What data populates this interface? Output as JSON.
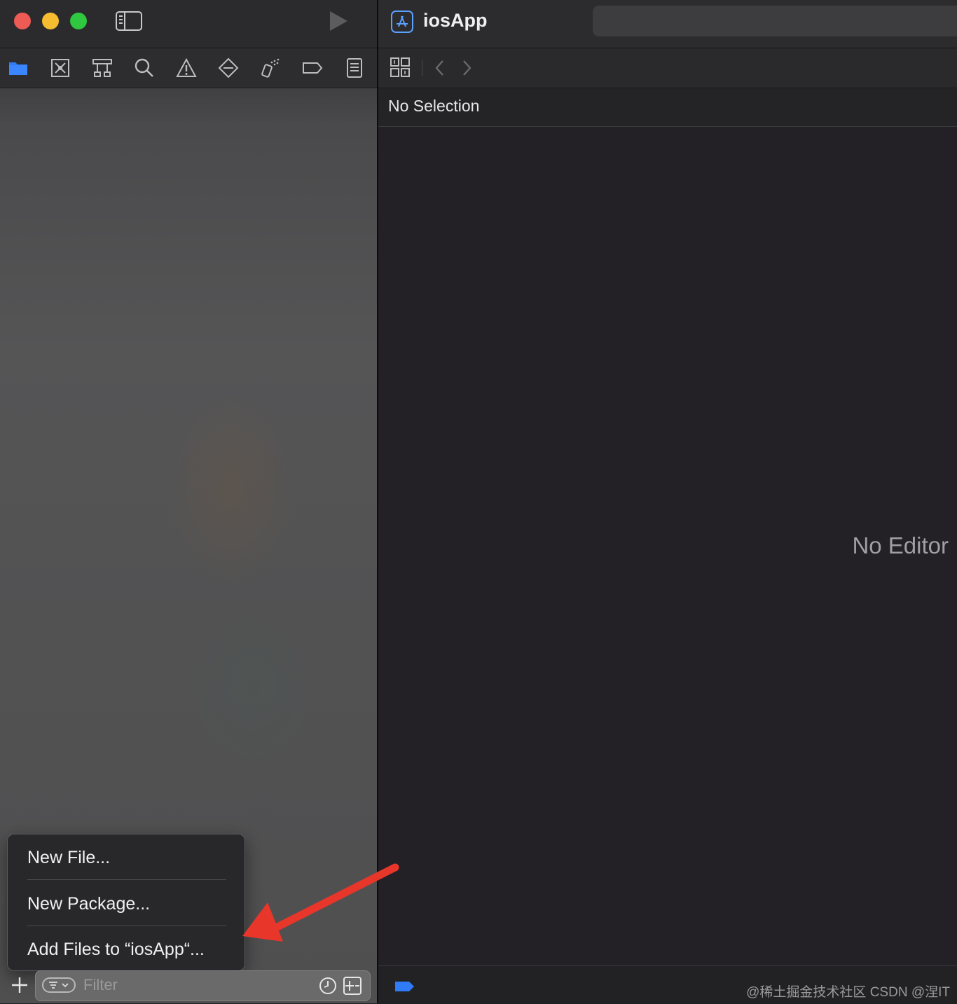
{
  "navigator": {
    "filter_placeholder": "Filter"
  },
  "menu": {
    "items": [
      {
        "label": "New File..."
      },
      {
        "label": "New Package..."
      },
      {
        "label": "Add Files to “iosApp“..."
      }
    ]
  },
  "editor": {
    "project_title": "iosApp",
    "jump_bar_text": "No Selection",
    "empty_message": "No Editor"
  },
  "watermark": "@稀土掘金技术社区 CSDN @涅IT",
  "colors": {
    "accent": "#2f7cf6",
    "close": "#ee5b55",
    "minimize": "#f5bd2f",
    "maximize": "#2fc840",
    "annotation_arrow": "#e8362b"
  },
  "icons": {
    "toolbar": [
      "folder-icon",
      "source-control-icon",
      "symbol-icon",
      "find-icon",
      "issue-icon",
      "test-icon",
      "debug-icon",
      "breakpoint-icon",
      "report-icon"
    ]
  }
}
